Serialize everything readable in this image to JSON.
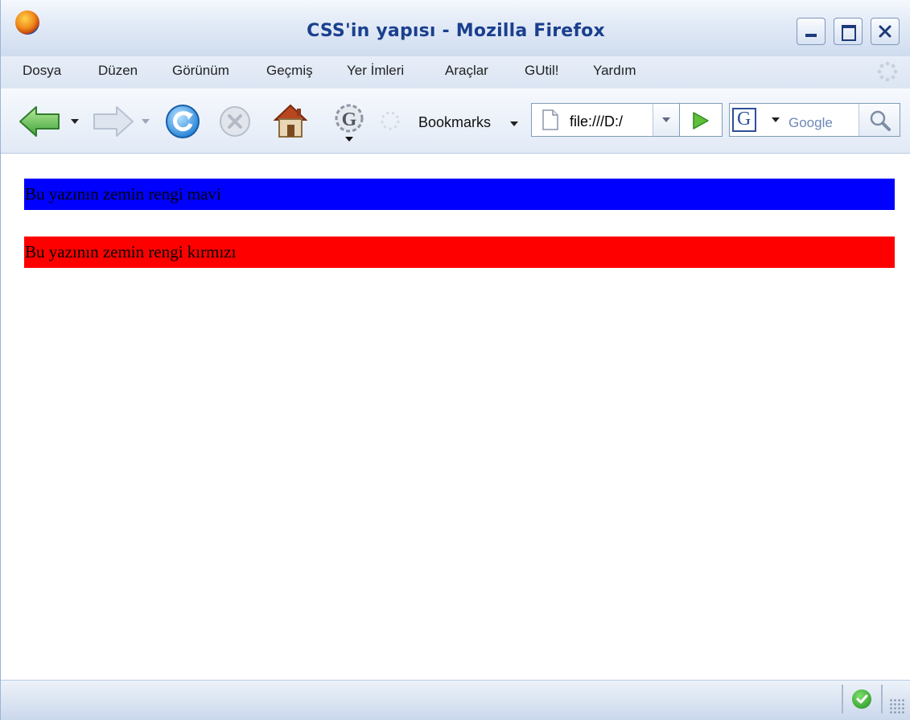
{
  "window": {
    "title": "CSS'in yapısı - Mozilla Firefox"
  },
  "menu": {
    "items": [
      "Dosya",
      "Düzen",
      "Görünüm",
      "Geçmiş",
      "Yer İmleri",
      "Araçlar",
      "GUtil!",
      "Yardım"
    ]
  },
  "toolbar": {
    "bookmarks_label": "Bookmarks",
    "url": "file:///D:/",
    "search_placeholder": "Google"
  },
  "content": {
    "paragraphs": [
      {
        "text": "Bu yazının zemin rengi mavi",
        "background": "#0000ff"
      },
      {
        "text": "Bu yazının zemin rengi kırmızı",
        "background": "#ff0000"
      }
    ]
  },
  "colors": {
    "title_text": "#1a3f8e",
    "chrome": "#dbe5f3"
  },
  "icons": [
    "firefox-logo-icon",
    "back-arrow-icon",
    "forward-arrow-icon",
    "reload-icon",
    "stop-icon",
    "home-icon",
    "gutil-icon",
    "loading-throbber-icon",
    "page-icon",
    "go-arrow-icon",
    "google-engine-icon",
    "search-magnifier-icon",
    "status-ok-icon"
  ]
}
